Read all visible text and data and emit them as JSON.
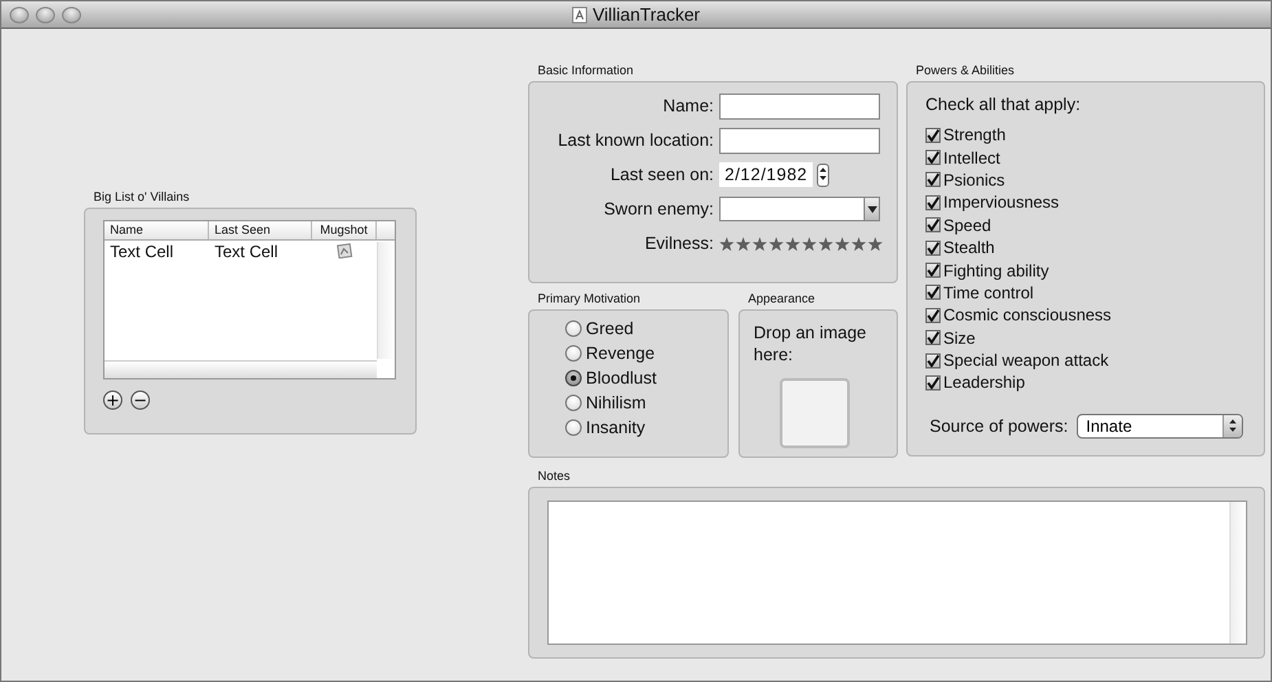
{
  "window": {
    "title": "VillianTracker"
  },
  "villain_list": {
    "title": "Big List o' Villains",
    "columns": [
      "Name",
      "Last Seen",
      "Mugshot"
    ],
    "rows": [
      {
        "name": "Text Cell",
        "last_seen": "Text Cell"
      }
    ],
    "buttons": [
      "+",
      "−"
    ]
  },
  "basic_information": {
    "title": "Basic Information",
    "fields": [
      {
        "kind": "text",
        "label": "Name:"
      },
      {
        "kind": "text",
        "label": "Last known location:"
      },
      {
        "kind": "date",
        "label": "Last seen on:",
        "value": "2/12/1982"
      },
      {
        "kind": "combo",
        "label": "Sworn enemy:"
      }
    ],
    "evilness": {
      "label": "Evilness:",
      "stars": 10
    }
  },
  "primary_motivation": {
    "title": "Primary Motivation",
    "options": [
      {
        "label": "Greed",
        "selected": false
      },
      {
        "label": "Revenge",
        "selected": false
      },
      {
        "label": "Bloodlust",
        "selected": true
      },
      {
        "label": "Nihilism",
        "selected": false
      },
      {
        "label": "Insanity",
        "selected": false
      }
    ]
  },
  "appearance": {
    "title": "Appearance",
    "prompt": "Drop an image here:"
  },
  "powers": {
    "title": "Powers & Abilities",
    "instruction": "Check all that apply:",
    "items": [
      {
        "label": "Strength",
        "checked": true
      },
      {
        "label": "Intellect",
        "checked": true
      },
      {
        "label": "Psionics",
        "checked": true
      },
      {
        "label": "Imperviousness",
        "checked": true
      },
      {
        "label": "Speed",
        "checked": true
      },
      {
        "label": "Stealth",
        "checked": true
      },
      {
        "label": "Fighting ability",
        "checked": true
      },
      {
        "label": "Time control",
        "checked": true
      },
      {
        "label": "Cosmic consciousness",
        "checked": true
      },
      {
        "label": "Size",
        "checked": true
      },
      {
        "label": "Special weapon attack",
        "checked": true
      },
      {
        "label": "Leadership",
        "checked": true
      }
    ],
    "source": {
      "label": "Source of powers:",
      "value": "Innate"
    }
  },
  "notes": {
    "title": "Notes"
  }
}
